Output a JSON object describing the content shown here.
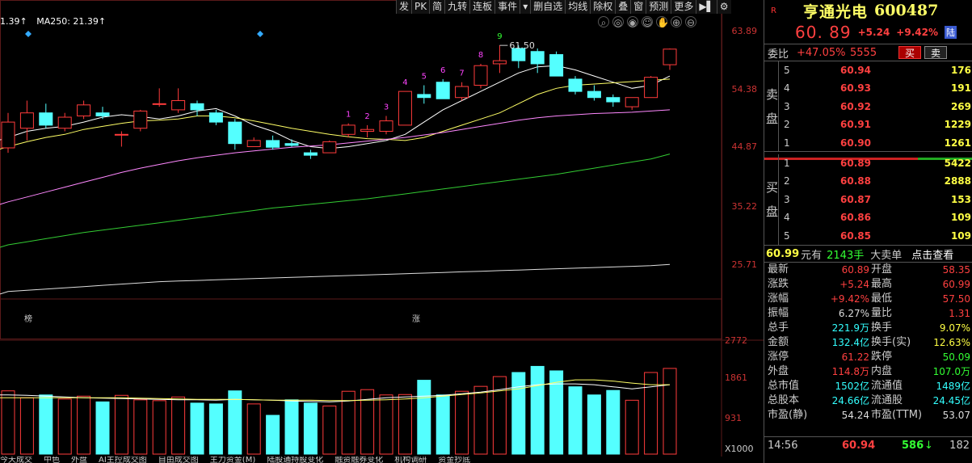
{
  "toolbar": {
    "items": [
      "发",
      "PK",
      "简",
      "九转",
      "连板",
      "事件",
      "▾",
      "删自选",
      "均线",
      "除权",
      "叠",
      "窗",
      "预测",
      "更多",
      "▶▌",
      "⚙"
    ]
  },
  "ma_legend": {
    "ma5_text": "1.39↑",
    "ma250_text": "MA250: 21.39↑"
  },
  "chart_icon_names": [
    "search-icon",
    "zoom-in-icon",
    "eye-icon",
    "face-icon",
    "hand-icon",
    "zoom-out-icon",
    "minus-icon"
  ],
  "price_axis_labels": [
    "63.89",
    "54.38",
    "44.87",
    "35.22",
    "25.71"
  ],
  "volume_axis_labels": [
    "2772",
    "1861",
    "931",
    "X1000"
  ],
  "peak_label": "61.50",
  "markers": {
    "bang": "榜",
    "zhang": "涨"
  },
  "bottom_tabs": [
    "今天成交",
    "中色",
    "外盘",
    "AI主控成交图",
    "自由成交图",
    "主力资金(M)",
    "陆股通持股变化",
    "融资融券变化",
    "机构调研",
    "资金抄底"
  ],
  "chart_data": {
    "type": "candlestick",
    "price_ylim": [
      25.71,
      63.89
    ],
    "volume_ylim": [
      0,
      2772
    ],
    "candles": [
      {
        "o": 44.8,
        "h": 50.5,
        "l": 44.0,
        "c": 49.0,
        "v": 1550
      },
      {
        "o": 48.0,
        "h": 52.5,
        "l": 46.0,
        "c": 50.5,
        "v": 1380
      },
      {
        "o": 50.5,
        "h": 52.0,
        "l": 48.0,
        "c": 48.5,
        "v": 1450
      },
      {
        "o": 48.0,
        "h": 50.5,
        "l": 47.5,
        "c": 49.8,
        "v": 1350
      },
      {
        "o": 50.0,
        "h": 52.5,
        "l": 49.5,
        "c": 51.8,
        "v": 1420
      },
      {
        "o": 50.5,
        "h": 51.5,
        "l": 49.5,
        "c": 50.0,
        "v": 1280
      },
      {
        "o": 47.0,
        "h": 47.5,
        "l": 45.0,
        "c": 47.0,
        "v": 1440
      },
      {
        "o": 48.0,
        "h": 51.0,
        "l": 47.5,
        "c": 50.8,
        "v": 1330
      },
      {
        "o": 52.0,
        "h": 54.5,
        "l": 51.5,
        "c": 52.0,
        "v": 1310
      },
      {
        "o": 51.0,
        "h": 54.5,
        "l": 50.5,
        "c": 52.5,
        "v": 1400
      },
      {
        "o": 52.0,
        "h": 52.5,
        "l": 50.0,
        "c": 51.0,
        "v": 1250
      },
      {
        "o": 50.5,
        "h": 51.0,
        "l": 48.5,
        "c": 49.0,
        "v": 1230
      },
      {
        "o": 49.0,
        "h": 49.5,
        "l": 44.5,
        "c": 45.5,
        "v": 1550
      },
      {
        "o": 45.0,
        "h": 46.5,
        "l": 45.0,
        "c": 46.0,
        "v": 1230
      },
      {
        "o": 46.0,
        "h": 46.8,
        "l": 44.5,
        "c": 44.9,
        "v": 950
      },
      {
        "o": 45.5,
        "h": 46.2,
        "l": 45.0,
        "c": 45.2,
        "v": 1330
      },
      {
        "o": 44.0,
        "h": 44.5,
        "l": 43.0,
        "c": 43.6,
        "v": 1250
      },
      {
        "o": 44.0,
        "h": 46.0,
        "l": 44.0,
        "c": 45.8,
        "v": 1180
      },
      {
        "o": 47.0,
        "h": 48.8,
        "l": 46.5,
        "c": 48.5,
        "v": 1540
      },
      {
        "o": 47.5,
        "h": 48.5,
        "l": 46.5,
        "c": 47.8,
        "v": 1580
      },
      {
        "o": 47.5,
        "h": 50.0,
        "l": 47.0,
        "c": 49.2,
        "v": 1450
      },
      {
        "o": 48.5,
        "h": 54.0,
        "l": 48.5,
        "c": 54.0,
        "v": 1460
      },
      {
        "o": 53.5,
        "h": 55.0,
        "l": 52.0,
        "c": 53.0,
        "v": 1810
      },
      {
        "o": 55.5,
        "h": 56.0,
        "l": 53.0,
        "c": 52.8,
        "v": 1450
      },
      {
        "o": 53.0,
        "h": 55.5,
        "l": 52.5,
        "c": 54.8,
        "v": 1540
      },
      {
        "o": 55.0,
        "h": 58.5,
        "l": 54.5,
        "c": 58.2,
        "v": 1660
      },
      {
        "o": 58.5,
        "h": 61.5,
        "l": 57.0,
        "c": 59.0,
        "v": 1900
      },
      {
        "o": 61.0,
        "h": 61.5,
        "l": 57.8,
        "c": 59.0,
        "v": 2000
      },
      {
        "o": 60.5,
        "h": 61.0,
        "l": 57.0,
        "c": 58.5,
        "v": 2150
      },
      {
        "o": 60.0,
        "h": 60.5,
        "l": 57.0,
        "c": 56.5,
        "v": 2040
      },
      {
        "o": 56.0,
        "h": 56.5,
        "l": 53.5,
        "c": 54.0,
        "v": 1650
      },
      {
        "o": 54.0,
        "h": 55.0,
        "l": 52.5,
        "c": 53.0,
        "v": 1450
      },
      {
        "o": 53.0,
        "h": 53.5,
        "l": 51.5,
        "c": 52.3,
        "v": 1560
      },
      {
        "o": 51.5,
        "h": 53.0,
        "l": 51.0,
        "c": 53.0,
        "v": 1320
      },
      {
        "o": 53.0,
        "h": 56.5,
        "l": 53.0,
        "c": 56.3,
        "v": 2000
      },
      {
        "o": 58.35,
        "h": 60.99,
        "l": 57.5,
        "c": 60.89,
        "v": 2100
      }
    ],
    "candle_numbers": {
      "18": "1",
      "19": "2",
      "20": "3",
      "21": "4",
      "22": "5",
      "23": "6",
      "24": "7",
      "25": "8",
      "26": "9"
    },
    "ma_lines": [
      {
        "name": "MA5",
        "color": "#ffffff",
        "values": [
          46.5,
          47.5,
          48.0,
          48.3,
          49.0,
          49.8,
          50.2,
          49.9,
          49.5,
          50.0,
          50.8,
          51.2,
          50.0,
          48.5,
          47.5,
          46.0,
          45.0,
          44.7,
          45.0,
          45.5,
          46.0,
          47.0,
          49.0,
          51.0,
          52.5,
          54.0,
          55.5,
          57.0,
          58.0,
          58.2,
          57.5,
          56.5,
          55.5,
          54.5,
          55.0,
          56.5
        ]
      },
      {
        "name": "MA10",
        "color": "#ffff66",
        "values": [
          45.0,
          45.8,
          46.5,
          47.0,
          47.8,
          48.3,
          48.8,
          49.2,
          49.3,
          49.5,
          50.0,
          50.0,
          49.7,
          49.2,
          48.6,
          48.0,
          47.5,
          47.0,
          46.6,
          46.3,
          46.2,
          46.0,
          46.5,
          47.5,
          48.5,
          49.5,
          50.5,
          52.0,
          53.5,
          54.5,
          55.0,
          55.2,
          55.4,
          55.6,
          55.8,
          56.0
        ]
      },
      {
        "name": "MA20",
        "color": "#ff88ff",
        "values": [
          36.0,
          36.8,
          37.6,
          38.4,
          39.2,
          40.0,
          40.8,
          41.5,
          42.1,
          42.7,
          43.2,
          43.6,
          44.0,
          44.3,
          44.6,
          44.9,
          45.1,
          45.3,
          45.6,
          45.9,
          46.2,
          46.5,
          46.9,
          47.3,
          47.8,
          48.3,
          48.8,
          49.3,
          49.7,
          50.0,
          50.2,
          50.4,
          50.5,
          50.6,
          50.8,
          51.0
        ]
      },
      {
        "name": "MA60",
        "color": "#33cc33",
        "values": [
          29.0,
          29.5,
          30.0,
          30.5,
          31.0,
          31.4,
          31.8,
          32.2,
          32.6,
          33.0,
          33.4,
          33.8,
          34.2,
          34.6,
          35.0,
          35.3,
          35.6,
          35.9,
          36.2,
          36.5,
          36.9,
          37.3,
          37.7,
          38.1,
          38.5,
          38.9,
          39.3,
          39.7,
          40.1,
          40.5,
          41.0,
          41.5,
          42.0,
          42.5,
          43.0,
          43.8
        ]
      },
      {
        "name": "MA250",
        "color": "#dddddd",
        "values": [
          21.39,
          21.6,
          21.8,
          22.0,
          22.2,
          22.4,
          22.6,
          22.8,
          23.0,
          23.1,
          23.2,
          23.3,
          23.4,
          23.5,
          23.6,
          23.7,
          23.8,
          23.9,
          24.0,
          24.1,
          24.2,
          24.3,
          24.4,
          24.5,
          24.6,
          24.7,
          24.8,
          24.9,
          25.0,
          25.1,
          25.2,
          25.3,
          25.4,
          25.5,
          25.6,
          25.8
        ]
      }
    ],
    "volume_ma": [
      {
        "name": "VMA5",
        "color": "#ffffff",
        "values": [
          1450,
          1440,
          1420,
          1400,
          1380,
          1370,
          1360,
          1350,
          1340,
          1330,
          1330,
          1320,
          1340,
          1330,
          1320,
          1300,
          1290,
          1280,
          1300,
          1340,
          1380,
          1400,
          1420,
          1440,
          1480,
          1520,
          1580,
          1650,
          1700,
          1720,
          1720,
          1700,
          1650,
          1600,
          1650,
          1700
        ]
      },
      {
        "name": "VMA10",
        "color": "#ffff66",
        "values": [
          1380,
          1380,
          1380,
          1380,
          1380,
          1380,
          1380,
          1370,
          1360,
          1350,
          1340,
          1340,
          1340,
          1330,
          1320,
          1320,
          1320,
          1310,
          1310,
          1320,
          1330,
          1350,
          1380,
          1420,
          1460,
          1500,
          1550,
          1600,
          1680,
          1760,
          1820,
          1820,
          1790,
          1740,
          1700,
          1700
        ]
      }
    ]
  },
  "quote": {
    "r_badge": "R",
    "name": "亨通光电",
    "code": "600487",
    "price": "60. 89",
    "change": "+5.24",
    "change_pct": "+9.42%",
    "exchange": "陆",
    "ratio_label": "委比",
    "ratio_pct": "+47.05%",
    "ratio_diff": "5555",
    "buy_btn": "买",
    "sell_btn": "卖",
    "sell_side_label": [
      "卖",
      "盘"
    ],
    "buy_side_label": [
      "买",
      "盘"
    ],
    "sell_book": [
      {
        "lvl": "5",
        "px": "60.94",
        "vol": "176"
      },
      {
        "lvl": "4",
        "px": "60.93",
        "vol": "191"
      },
      {
        "lvl": "3",
        "px": "60.92",
        "vol": "269"
      },
      {
        "lvl": "2",
        "px": "60.91",
        "vol": "1229"
      },
      {
        "lvl": "1",
        "px": "60.90",
        "vol": "1261"
      }
    ],
    "buy_book": [
      {
        "lvl": "1",
        "px": "60.89",
        "vol": "5422"
      },
      {
        "lvl": "2",
        "px": "60.88",
        "vol": "2888"
      },
      {
        "lvl": "3",
        "px": "60.87",
        "vol": "153"
      },
      {
        "lvl": "4",
        "px": "60.86",
        "vol": "109"
      },
      {
        "lvl": "5",
        "px": "60.85",
        "vol": "109"
      }
    ],
    "big_order": {
      "price": "60.99",
      "unit": "元有",
      "vol": "2143手",
      "title": "大卖单",
      "link": "点击查看"
    },
    "stats": [
      {
        "k1": "最新",
        "v1": "60.89",
        "c1": "red",
        "k2": "开盘",
        "v2": "58.35",
        "c2": "red"
      },
      {
        "k1": "涨跌",
        "v1": "+5.24",
        "c1": "red",
        "k2": "最高",
        "v2": "60.99",
        "c2": "red"
      },
      {
        "k1": "涨幅",
        "v1": "+9.42%",
        "c1": "red",
        "k2": "最低",
        "v2": "57.50",
        "c2": "red"
      },
      {
        "k1": "振幅",
        "v1": "6.27%",
        "c1": "white",
        "k2": "量比",
        "v2": "1.31",
        "c2": "red"
      },
      {
        "k1": "总手",
        "v1": "221.9万",
        "c1": "cyan",
        "k2": "换手",
        "v2": "9.07%",
        "c2": "yellow"
      },
      {
        "k1": "金额",
        "v1": "132.4亿",
        "c1": "cyan",
        "k2": "换手(实)",
        "v2": "12.63%",
        "c2": "yellow"
      },
      {
        "k1": "涨停",
        "v1": "61.22",
        "c1": "red",
        "k2": "跌停",
        "v2": "50.09",
        "c2": "green"
      },
      {
        "k1": "外盘",
        "v1": "114.8万",
        "c1": "red",
        "k2": "内盘",
        "v2": "107.0万",
        "c2": "green"
      },
      {
        "k1": "总市值",
        "v1": "1502亿",
        "c1": "cyan",
        "k2": "流通值",
        "v2": "1489亿",
        "c2": "cyan"
      },
      {
        "k1": "总股本",
        "v1": "24.66亿",
        "c1": "cyan",
        "k2": "流通股",
        "v2": "24.45亿",
        "c2": "cyan"
      },
      {
        "k1": "市盈(静)",
        "v1": "54.24",
        "c1": "white",
        "k2": "市盈(TTM)",
        "v2": "53.07",
        "c2": "white"
      }
    ],
    "tick": {
      "time": "14:56",
      "price": "60.94",
      "vol": "586",
      "arrow": "↓",
      "count": "182"
    }
  }
}
